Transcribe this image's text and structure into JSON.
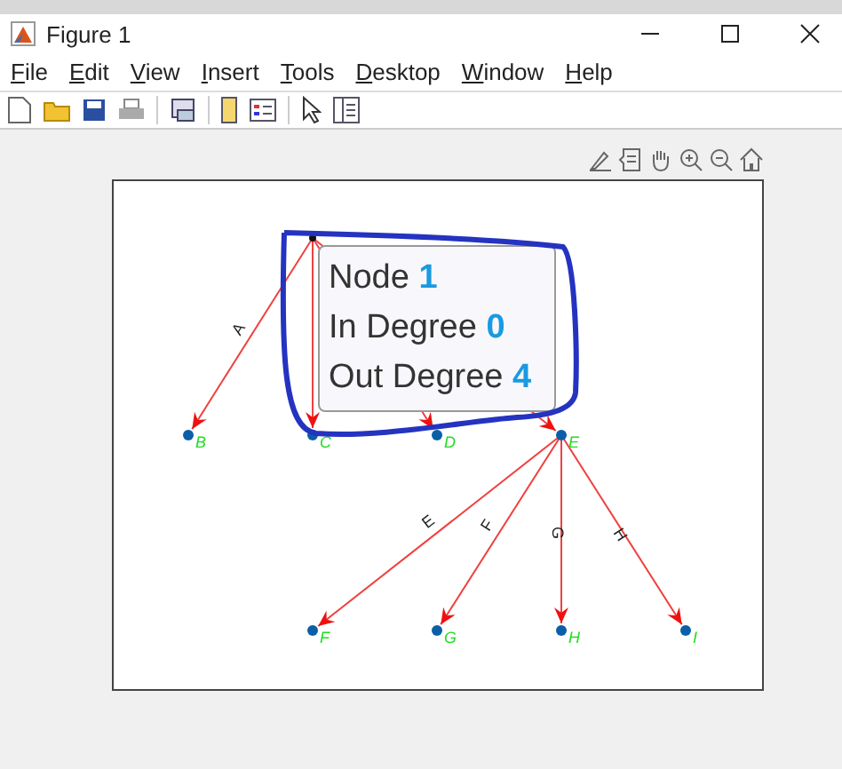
{
  "window": {
    "title": "Figure 1"
  },
  "menu": [
    "File",
    "Edit",
    "View",
    "Insert",
    "Tools",
    "Desktop",
    "Window",
    "Help"
  ],
  "graph": {
    "node_labels": [
      "B",
      "C",
      "D",
      "E",
      "F",
      "G",
      "H",
      "I"
    ],
    "edge_labels": [
      "A",
      "E",
      "F",
      "G",
      "H"
    ]
  },
  "datatip": {
    "rows": [
      {
        "label": "Node",
        "value": "1"
      },
      {
        "label": "In Degree",
        "value": "0"
      },
      {
        "label": "Out Degree",
        "value": "4"
      }
    ]
  }
}
